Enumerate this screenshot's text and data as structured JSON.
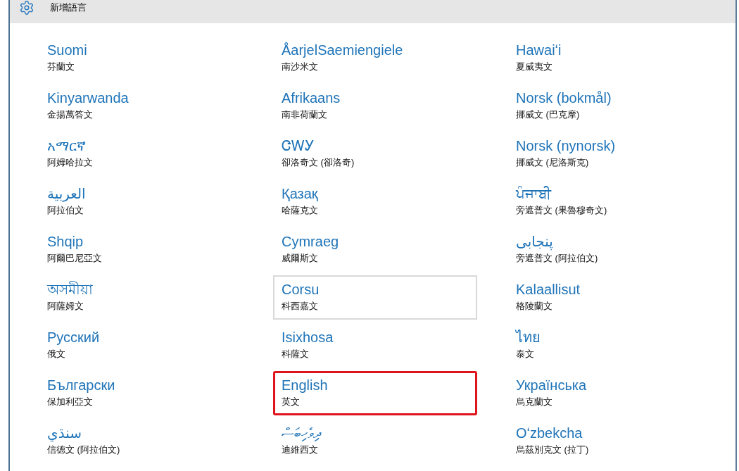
{
  "window": {
    "title": "新增語言"
  },
  "languages": [
    {
      "name": "Suomi",
      "description": "芬蘭文",
      "hovered": false,
      "highlighted": false
    },
    {
      "name": "ÅarjelSaemiengiele",
      "description": "南沙米文",
      "hovered": false,
      "highlighted": false
    },
    {
      "name": "Hawaiʻi",
      "description": "夏威夷文",
      "hovered": false,
      "highlighted": false
    },
    {
      "name": "Kinyarwanda",
      "description": "金揚萬答文",
      "hovered": false,
      "highlighted": false
    },
    {
      "name": "Afrikaans",
      "description": "南非荷蘭文",
      "hovered": false,
      "highlighted": false
    },
    {
      "name": "Norsk (bokmål)",
      "description": "挪威文 (巴克摩)",
      "hovered": false,
      "highlighted": false
    },
    {
      "name": "አማርኛ",
      "description": "阿姆哈拉文",
      "hovered": false,
      "highlighted": false
    },
    {
      "name": "ᏣᎳᎩ",
      "description": "卻洛奇文 (卻洛奇)",
      "hovered": false,
      "highlighted": false
    },
    {
      "name": "Norsk (nynorsk)",
      "description": "挪威文 (尼洛斯克)",
      "hovered": false,
      "highlighted": false
    },
    {
      "name": "العربية",
      "description": "阿拉伯文",
      "hovered": false,
      "highlighted": false
    },
    {
      "name": "Қазақ",
      "description": "哈薩克文",
      "hovered": false,
      "highlighted": false
    },
    {
      "name": "ਪੰਜਾਬੀ",
      "description": "旁遮普文 (果魯穆奇文)",
      "hovered": false,
      "highlighted": false
    },
    {
      "name": "Shqip",
      "description": "阿爾巴尼亞文",
      "hovered": false,
      "highlighted": false
    },
    {
      "name": "Cymraeg",
      "description": "威爾斯文",
      "hovered": false,
      "highlighted": false
    },
    {
      "name": "پنجابی",
      "description": "旁遮普文 (阿拉伯文)",
      "hovered": false,
      "highlighted": false
    },
    {
      "name": "অসমীয়া",
      "description": "阿薩姆文",
      "hovered": false,
      "highlighted": false
    },
    {
      "name": "Corsu",
      "description": "科西嘉文",
      "hovered": true,
      "highlighted": false
    },
    {
      "name": "Kalaallisut",
      "description": "格陵蘭文",
      "hovered": false,
      "highlighted": false
    },
    {
      "name": "Русский",
      "description": "俄文",
      "hovered": false,
      "highlighted": false
    },
    {
      "name": "Isixhosa",
      "description": "科薩文",
      "hovered": false,
      "highlighted": false
    },
    {
      "name": "ไทย",
      "description": "泰文",
      "hovered": false,
      "highlighted": false
    },
    {
      "name": "Български",
      "description": "保加利亞文",
      "hovered": false,
      "highlighted": false
    },
    {
      "name": "English",
      "description": "英文",
      "hovered": false,
      "highlighted": true
    },
    {
      "name": "Українська",
      "description": "烏克蘭文",
      "hovered": false,
      "highlighted": false
    },
    {
      "name": "سنڌي",
      "description": "信德文 (阿拉伯文)",
      "hovered": false,
      "highlighted": false
    },
    {
      "name": "ދިވެހިބަސް",
      "description": "迪維西文",
      "hovered": false,
      "highlighted": false
    },
    {
      "name": "Oʻzbekcha",
      "description": "烏茲別克文 (拉丁)",
      "hovered": false,
      "highlighted": false
    }
  ]
}
